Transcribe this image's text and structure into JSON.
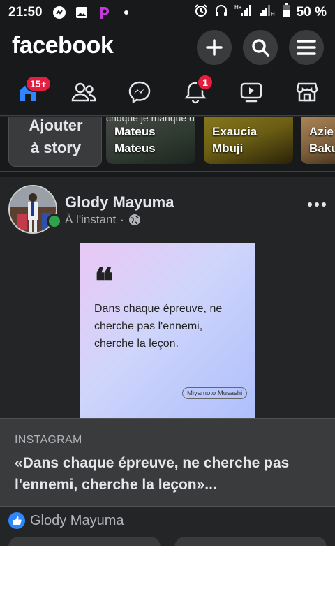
{
  "status_bar": {
    "time": "21:50",
    "battery_percent": "50 %",
    "icons": [
      "chat-icon",
      "image-icon",
      "picsart-icon",
      "dot-icon",
      "alarm-icon",
      "headphones-icon",
      "signal-h-plus-icon",
      "signal-h-icon",
      "battery-icon"
    ]
  },
  "header": {
    "logo": "facebook",
    "buttons": [
      "plus-icon",
      "search-icon",
      "menu-icon"
    ]
  },
  "nav": {
    "items": [
      {
        "name": "home",
        "icon": "home-icon",
        "badge": "15+"
      },
      {
        "name": "friends",
        "icon": "friends-icon",
        "badge": ""
      },
      {
        "name": "messenger",
        "icon": "messenger-icon",
        "badge": ""
      },
      {
        "name": "notifications",
        "icon": "bell-icon",
        "badge": "1"
      },
      {
        "name": "watch",
        "icon": "video-icon",
        "badge": ""
      },
      {
        "name": "marketplace",
        "icon": "store-icon",
        "badge": ""
      }
    ]
  },
  "stories": {
    "add_label_line1": "Ajouter",
    "add_label_line2": "à story",
    "items": [
      {
        "name_line1": "Mateus",
        "name_line2": "Mateus",
        "overlay": "choqué je manque de mot mob"
      },
      {
        "name_line1": "Exaucia",
        "name_line2": "Mbuji",
        "overlay": ""
      },
      {
        "name_line1": "Azie",
        "name_line2": "Baku",
        "overlay": ""
      }
    ]
  },
  "post": {
    "author": "Glody Mayuma",
    "timestamp": "À l'instant",
    "separator": "·",
    "privacy_icon": "globe-icon",
    "quote_image": {
      "mark": "❝",
      "text": "Dans chaque épreuve, ne cherche pas l'ennemi, cherche la leçon.",
      "author": "Miyamoto Musashi"
    },
    "link": {
      "source": "INSTAGRAM",
      "title": "«Dans chaque épreuve, ne cherche pas l'ennemi, cherche la leçon»..."
    },
    "reactions": {
      "icon": "like-icon",
      "names": "Glody Mayuma"
    }
  },
  "colors": {
    "background": "#242526",
    "bar": "#18191a",
    "accent": "#2d88ff",
    "badge": "#e41e3f",
    "online": "#31a24c"
  }
}
